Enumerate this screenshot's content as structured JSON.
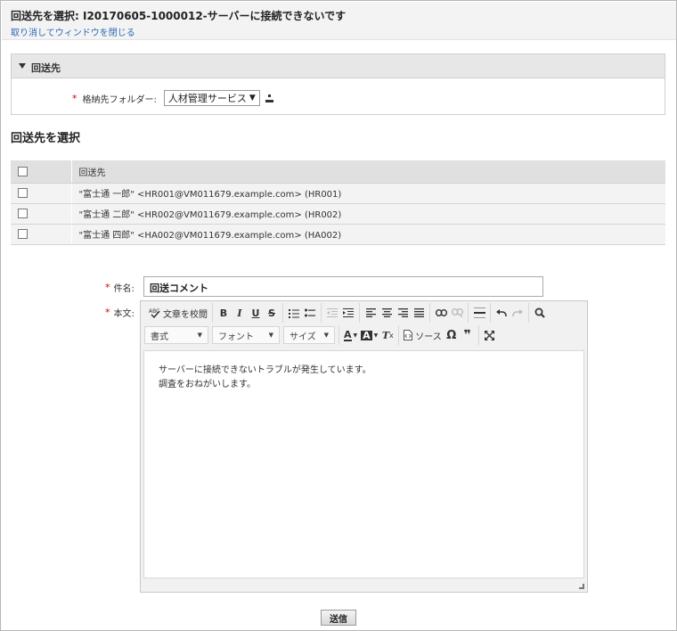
{
  "header": {
    "title": "回送先を選択: I20170605-1000012-サーバーに接続できないです",
    "close_link": "取り消してウィンドウを閉じる"
  },
  "section": {
    "label": "回送先",
    "folder_label": "格納先フォルダー:",
    "folder_value": "人材管理サービス"
  },
  "select_heading": "回送先を選択",
  "table": {
    "header": "回送先",
    "rows": [
      {
        "recipient": "\"富士通 一郎\" <HR001@VM011679.example.com> (HR001)",
        "checked": false
      },
      {
        "recipient": "\"富士通 二郎\" <HR002@VM011679.example.com> (HR002)",
        "checked": false
      },
      {
        "recipient": "\"富士通 四郎\" <HA002@VM011679.example.com> (HA002)",
        "checked": false
      }
    ]
  },
  "form": {
    "required_mark": "*",
    "subject_label": "件名:",
    "subject_value": "回送コメント",
    "body_label": "本文:"
  },
  "editor": {
    "spellcheck_label": "文章を校閲",
    "format_combo": "書式",
    "font_combo": "フォント",
    "size_combo": "サイズ",
    "source_label": "ソース",
    "body_lines": [
      "サーバーに接続できないトラブルが発生しています。",
      "調査をおねがいします。"
    ]
  },
  "send_label": "送信",
  "colors": {
    "link": "#2a6bb5",
    "required": "#d40000",
    "header_bg": "#f3f3f3",
    "table_header_bg": "#e0e0e0"
  }
}
